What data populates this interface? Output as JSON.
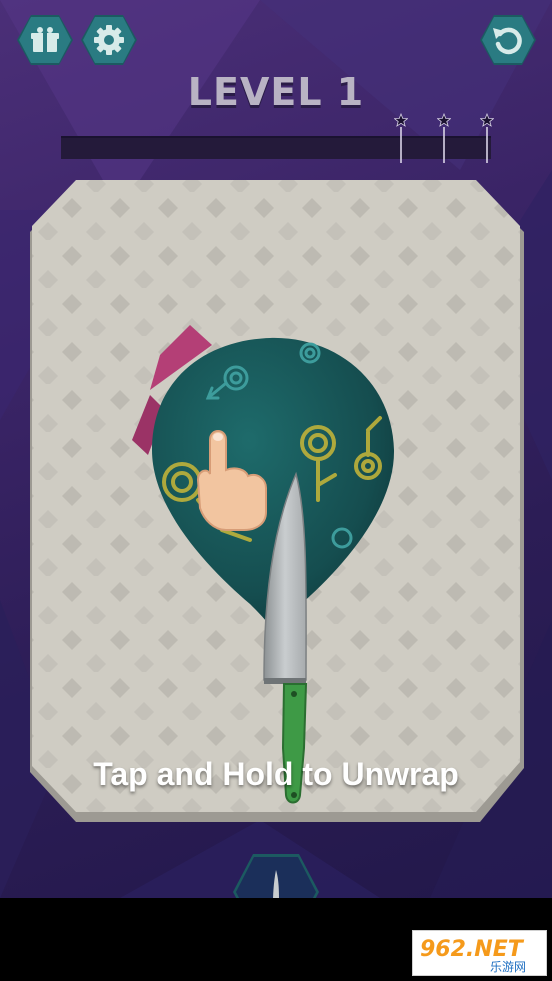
{
  "level": {
    "title": "LEVEL 1"
  },
  "progress": {
    "value": 0,
    "star_thresholds": [
      0.79,
      0.89,
      0.99
    ]
  },
  "toolbar": {
    "gift_icon": "gift-icon",
    "settings_icon": "gear-icon",
    "restart_icon": "restart-icon"
  },
  "hint": {
    "text": "Tap and Hold to Unwrap"
  },
  "tool": {
    "icon": "knife-icon"
  },
  "colors": {
    "button_fill": "#2a7b82",
    "board": "#cfccc3",
    "wrapped_item": "#1f5f5f",
    "ribbon": "#b43f76",
    "knife_handle": "#3e9a46"
  },
  "watermark": {
    "brand": "962.NET",
    "subtitle": "乐游网"
  }
}
